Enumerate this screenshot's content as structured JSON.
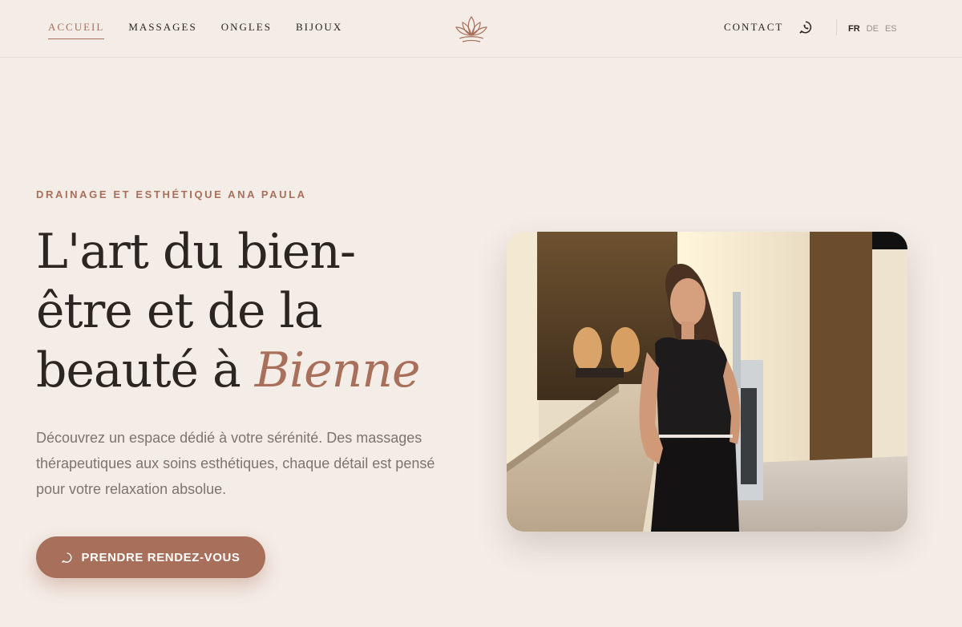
{
  "nav": {
    "items": [
      {
        "label": "ACCUEIL",
        "active": true
      },
      {
        "label": "MASSAGES",
        "active": false
      },
      {
        "label": "ONGLES",
        "active": false
      },
      {
        "label": "BIJOUX",
        "active": false
      }
    ],
    "logo_icon": "lotus-icon",
    "contact_label": "CONTACT",
    "whatsapp_icon": "whatsapp-icon",
    "languages": [
      {
        "label": "FR",
        "active": true
      },
      {
        "label": "DE",
        "active": false
      },
      {
        "label": "ES",
        "active": false
      }
    ]
  },
  "hero": {
    "eyebrow": "DRAINAGE ET ESTHÉTIQUE ANA PAULA",
    "headline_line1": "L'art du bien-",
    "headline_line2": "être et de la",
    "headline_line3_plain": "beauté à ",
    "headline_line3_accent": "Bienne",
    "description": "Découvrez un espace dédié à votre sérénité. Des massages thérapeutiques aux soins esthétiques, chaque détail est pensé pour votre relaxation absolue.",
    "cta_label": "PRENDRE RENDEZ-VOUS",
    "cta_icon": "whatsapp-icon"
  },
  "colors": {
    "background": "#f4ece6",
    "accent": "#a8705a",
    "text": "#2b2622",
    "muted": "#7d746d"
  }
}
